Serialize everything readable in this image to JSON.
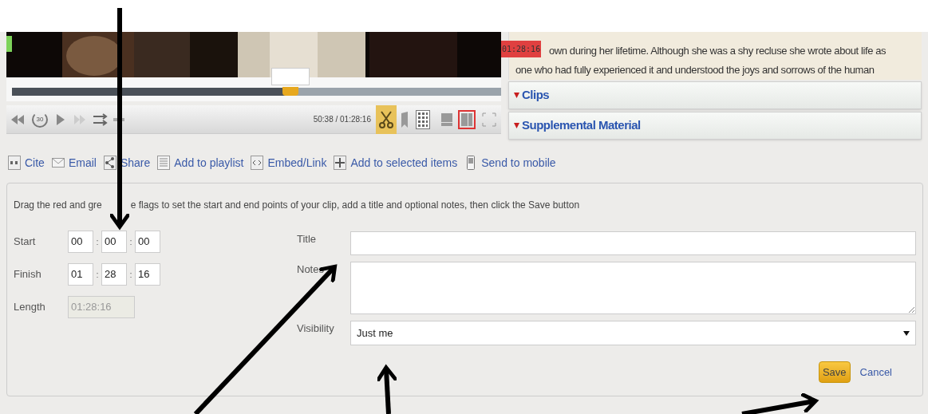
{
  "player": {
    "end_flag": "01:28:16",
    "level": 0.57,
    "skip_seconds": "30",
    "time": "50:38 / 01:28:16",
    "clip_mode": true,
    "layouts": [
      {
        "selected": false
      },
      {
        "selected": true
      }
    ]
  },
  "description": {
    "lines": [
      "own during her lifetime. Although she was a shy recluse she wrote about life as",
      "one who had fully experienced it and understood the joys and sorrows of the human"
    ]
  },
  "sections": [
    {
      "label": "Clips"
    },
    {
      "label": "Supplemental Material"
    }
  ],
  "actions": [
    {
      "kind": "cite",
      "label": "Cite"
    },
    {
      "kind": "email",
      "label": "Email"
    },
    {
      "kind": "share",
      "label": "Share"
    },
    {
      "kind": "playlist",
      "label": "Add to playlist"
    },
    {
      "kind": "embed",
      "label": "Embed/Link"
    },
    {
      "kind": "add",
      "label": "Add to selected items"
    },
    {
      "kind": "mobile",
      "label": "Send to mobile"
    }
  ],
  "clip_form": {
    "instructions": [
      "Drag the red and gre",
      "e flags to set the start and end points of your clip, add a title and optional notes, then click the Save button"
    ],
    "start_label": "Start",
    "start": [
      "00",
      "00",
      "00"
    ],
    "finish_label": "Finish",
    "finish": [
      "01",
      "28",
      "16"
    ],
    "length_label": "Length",
    "length": "01:28:16",
    "title_label": "Title",
    "notes_label": "Notes",
    "visibility_label": "Visibility",
    "visibility": "Just me",
    "save": "Save",
    "cancel": "Cancel",
    "separator": ":"
  }
}
